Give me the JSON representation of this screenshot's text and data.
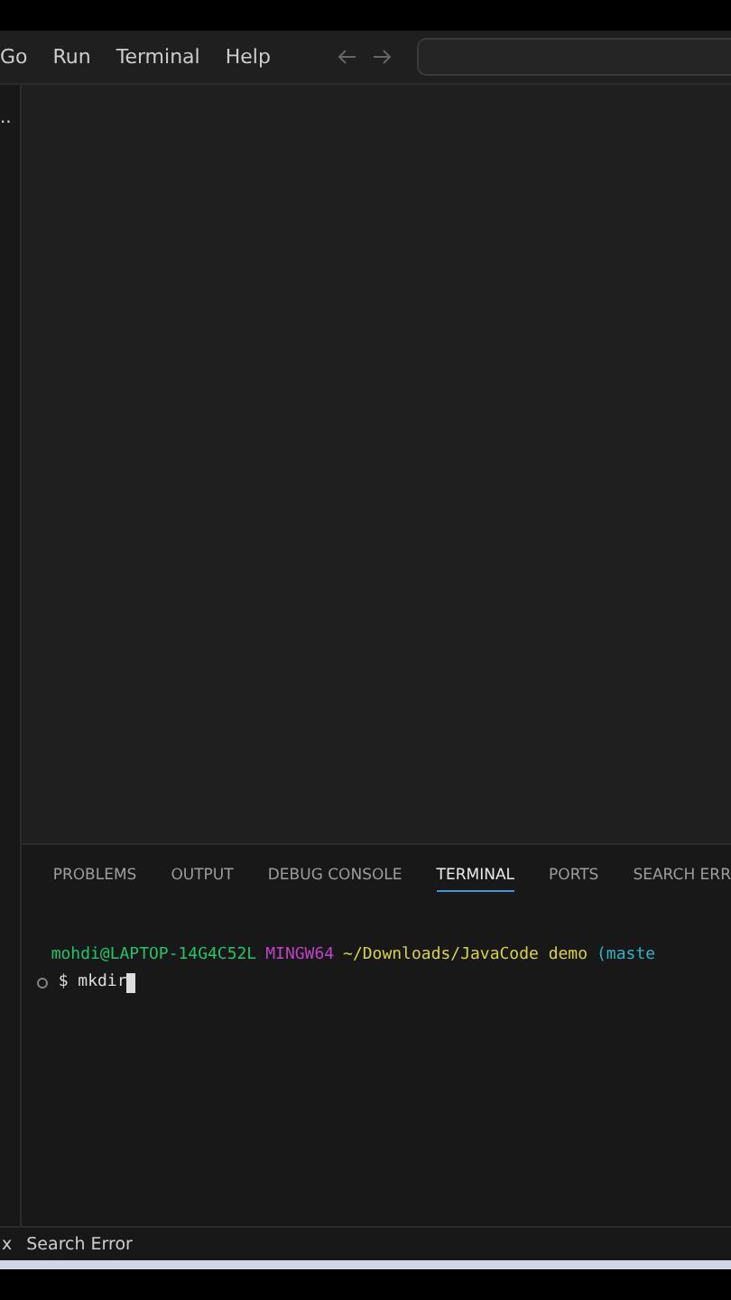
{
  "menu": [
    "Go",
    "Run",
    "Terminal",
    "Help"
  ],
  "sidebar": {
    "label": ".."
  },
  "panel": {
    "tabs": [
      {
        "label": "PROBLEMS",
        "selected": false
      },
      {
        "label": "OUTPUT",
        "selected": false
      },
      {
        "label": "DEBUG CONSOLE",
        "selected": false
      },
      {
        "label": "TERMINAL",
        "selected": true
      },
      {
        "label": "PORTS",
        "selected": false
      },
      {
        "label": "SEARCH ERR",
        "selected": false
      }
    ],
    "terminal": {
      "prompt": [
        {
          "text": "mohdi@LAPTOP-14G4C52L",
          "color": "#23c36b"
        },
        {
          "text": "MINGW64",
          "color": "#c042c8"
        },
        {
          "text": "~/Downloads/JavaCode demo",
          "color": "#d8d24a"
        },
        {
          "text": "(maste",
          "color": "#2fb4c8"
        }
      ],
      "command": "$ mkdir"
    }
  },
  "status_bar": [
    "x",
    "Search Error"
  ]
}
